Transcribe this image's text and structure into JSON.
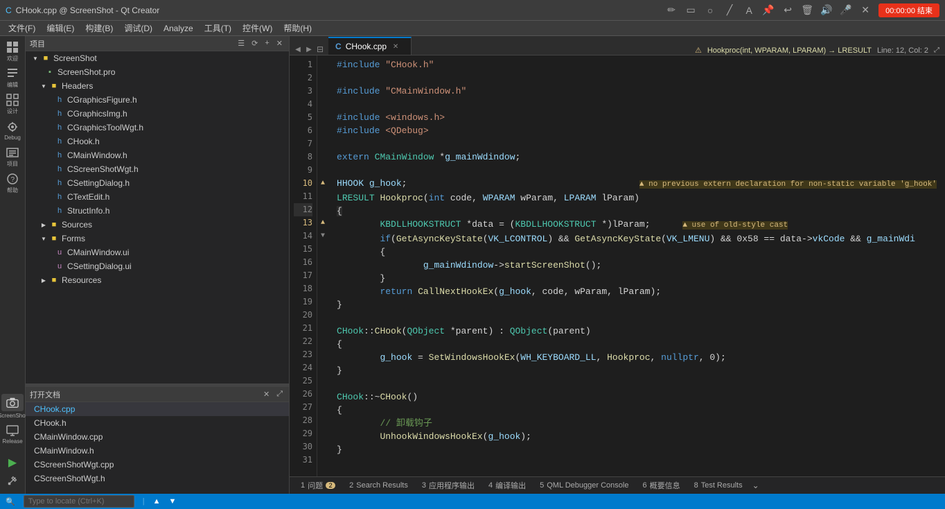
{
  "titlebar": {
    "title": "CHook.cpp @ ScreenShot - Qt Creator",
    "icons": [
      "pencil",
      "square",
      "circle",
      "triangle",
      "anchor",
      "scissors",
      "undo",
      "delete",
      "speaker",
      "mic",
      "close"
    ],
    "timer": "00:00:00 结束"
  },
  "menubar": {
    "items": [
      "文件(F)",
      "编辑(E)",
      "构建(B)",
      "调试(D)",
      "Analyze",
      "工具(T)",
      "控件(W)",
      "帮助(H)"
    ]
  },
  "toolbar": {
    "project_label": "项目",
    "file_tab": "CHook.cpp",
    "breadcrumb": "Hookproc(int, WPARAM, LPARAM) → LRESULT",
    "position": "Line: 12, Col: 2"
  },
  "sidebar": {
    "items": [
      {
        "name": "welcome",
        "label": "欢迎",
        "icon": "⊞"
      },
      {
        "name": "edit",
        "label": "编辑",
        "icon": "✎"
      },
      {
        "name": "design",
        "label": "设计",
        "icon": "▦"
      },
      {
        "name": "debug",
        "label": "Debug",
        "icon": "🐛"
      },
      {
        "name": "project",
        "label": "项目",
        "icon": "⊡"
      },
      {
        "name": "help",
        "label": "帮助",
        "icon": "?"
      },
      {
        "name": "screenshot",
        "label": "ScreenShot",
        "icon": "📷"
      },
      {
        "name": "release",
        "label": "Release",
        "icon": "💻"
      }
    ]
  },
  "project_tree": {
    "header": "项目",
    "root": {
      "name": "ScreenShot",
      "children": [
        {
          "name": "ScreenShot.pro",
          "type": "file"
        },
        {
          "name": "Headers",
          "type": "folder",
          "expanded": true,
          "children": [
            {
              "name": "CGraphicsFigure.h",
              "type": "header"
            },
            {
              "name": "CGraphicsImg.h",
              "type": "header"
            },
            {
              "name": "CGraphicsToolWgt.h",
              "type": "header"
            },
            {
              "name": "CHook.h",
              "type": "header"
            },
            {
              "name": "CMainWindow.h",
              "type": "header"
            },
            {
              "name": "CScreenShotWgt.h",
              "type": "header"
            },
            {
              "name": "CSettingDialog.h",
              "type": "header"
            },
            {
              "name": "CTextEdit.h",
              "type": "header"
            },
            {
              "name": "StructInfo.h",
              "type": "header"
            }
          ]
        },
        {
          "name": "Sources",
          "type": "folder",
          "expanded": false
        },
        {
          "name": "Forms",
          "type": "folder",
          "expanded": true,
          "children": [
            {
              "name": "CMainWindow.ui",
              "type": "ui"
            },
            {
              "name": "CSettingDialog.ui",
              "type": "ui"
            }
          ]
        },
        {
          "name": "Resources",
          "type": "folder",
          "expanded": false
        }
      ]
    }
  },
  "open_docs": {
    "header": "打开文档",
    "items": [
      {
        "name": "CHook.cpp",
        "active": true
      },
      {
        "name": "CHook.h"
      },
      {
        "name": "CMainWindow.cpp"
      },
      {
        "name": "CMainWindow.h"
      },
      {
        "name": "CScreenShotWgt.cpp"
      },
      {
        "name": "CScreenShotWgt.h"
      }
    ]
  },
  "code": {
    "lines": [
      {
        "num": 1,
        "text": "#include \"CHook.h\"",
        "type": "normal"
      },
      {
        "num": 2,
        "text": "",
        "type": "normal"
      },
      {
        "num": 3,
        "text": "#include \"CMainWindow.h\"",
        "type": "normal"
      },
      {
        "num": 4,
        "text": "",
        "type": "normal"
      },
      {
        "num": 5,
        "text": "#include <windows.h>",
        "type": "normal"
      },
      {
        "num": 6,
        "text": "#include <QDebug>",
        "type": "normal"
      },
      {
        "num": 7,
        "text": "",
        "type": "normal"
      },
      {
        "num": 8,
        "text": "extern CMainWindow *g_mainWdindow;",
        "type": "normal"
      },
      {
        "num": 9,
        "text": "",
        "type": "normal"
      },
      {
        "num": 10,
        "text": "HHOOK g_hook;",
        "warn": true,
        "warn_msg": "no previous extern declaration for non-static variable 'g_hook'"
      },
      {
        "num": 11,
        "text": "LRESULT Hookproc(int code, WPARAM wParam, LPARAM lParam)",
        "type": "normal"
      },
      {
        "num": 12,
        "text": "{",
        "type": "normal",
        "active": true
      },
      {
        "num": 13,
        "text": "        KBDLLHOOKSTRUCT *data = (KBDLLHOOKSTRUCT *)lParam;",
        "warn": true,
        "warn_msg": "use of old-style cast"
      },
      {
        "num": 14,
        "text": "        if(GetAsyncKeyState(VK_LCONTROL) && GetAsyncKeyState(VK_LMENU) && 0x58 == data->vkCode && g_mainWdi",
        "fold": true,
        "type": "normal"
      },
      {
        "num": 15,
        "text": "        {",
        "type": "normal"
      },
      {
        "num": 16,
        "text": "                g_mainWdindow->startScreenShot();",
        "type": "normal"
      },
      {
        "num": 17,
        "text": "        }",
        "type": "normal"
      },
      {
        "num": 18,
        "text": "        return CallNextHookEx(g_hook, code, wParam, lParam);",
        "type": "normal"
      },
      {
        "num": 19,
        "text": "}",
        "type": "normal"
      },
      {
        "num": 20,
        "text": "",
        "type": "normal"
      },
      {
        "num": 21,
        "text": "CHook::CHook(QObject *parent) : QObject(parent)",
        "type": "normal"
      },
      {
        "num": 22,
        "text": "{",
        "type": "normal"
      },
      {
        "num": 23,
        "text": "        g_hook = SetWindowsHookEx(WH_KEYBOARD_LL, Hookproc, nullptr, 0);",
        "type": "normal"
      },
      {
        "num": 24,
        "text": "}",
        "type": "normal"
      },
      {
        "num": 25,
        "text": "",
        "type": "normal"
      },
      {
        "num": 26,
        "text": "CHook::~CHook()",
        "type": "normal"
      },
      {
        "num": 27,
        "text": "{",
        "type": "normal"
      },
      {
        "num": 28,
        "text": "        // 卸载钩子",
        "type": "comment"
      },
      {
        "num": 29,
        "text": "        UnhookWindowsHookEx(g_hook);",
        "type": "normal"
      },
      {
        "num": 30,
        "text": "}",
        "type": "normal"
      },
      {
        "num": 31,
        "text": "",
        "type": "normal"
      }
    ]
  },
  "bottom_tabs": [
    {
      "num": 1,
      "label": "问题",
      "badge": "2",
      "badge_type": "warn"
    },
    {
      "num": 2,
      "label": "Search Results"
    },
    {
      "num": 3,
      "label": "应用程序输出"
    },
    {
      "num": 4,
      "label": "编译输出"
    },
    {
      "num": 5,
      "label": "QML Debugger Console"
    },
    {
      "num": 6,
      "label": "概要信息"
    },
    {
      "num": 8,
      "label": "Test Results"
    }
  ],
  "statusbar": {
    "left": "",
    "right": ""
  },
  "locate": {
    "placeholder": "Type to locate (Ctrl+K)"
  }
}
